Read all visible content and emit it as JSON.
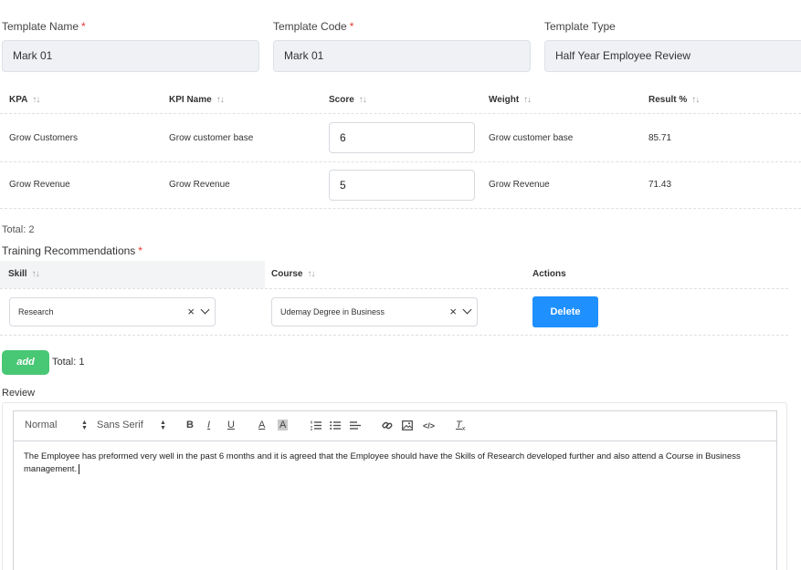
{
  "form": {
    "template_name": {
      "label": "Template Name",
      "required_mark": "*",
      "value": "Mark 01"
    },
    "template_code": {
      "label": "Template Code",
      "required_mark": "*",
      "value": "Mark 01"
    },
    "template_type": {
      "label": "Template Type",
      "value": "Half Year Employee Review"
    }
  },
  "kpa_table": {
    "headers": [
      "KPA",
      "KPI Name",
      "Score",
      "Weight",
      "Result %"
    ],
    "rows": [
      {
        "kpa": "Grow Customers",
        "kpi_name": "Grow customer base",
        "score": "6",
        "weight": "Grow customer base",
        "result": "85.71"
      },
      {
        "kpa": "Grow Revenue",
        "kpi_name": "Grow Revenue",
        "score": "5",
        "weight": "Grow Revenue",
        "result": "71.43"
      }
    ],
    "total": "Total: 2"
  },
  "training": {
    "label": "Training Recommendations",
    "required_mark": "*",
    "headers": {
      "skill": "Skill",
      "course": "Course",
      "actions": "Actions"
    },
    "rows": [
      {
        "skill": "Research",
        "course": "Udemay Degree in Business",
        "delete_label": "Delete"
      }
    ],
    "add_label": "add",
    "total": "Total: 1"
  },
  "review": {
    "label": "Review",
    "toolbar": {
      "header_select": "Normal",
      "font_select": "Sans Serif"
    },
    "text": "The Employee has preformed very well in the past 6 months and it is agreed that the Employee should have the Skills of Research developed further and also attend a Course in Business management."
  },
  "colors": {
    "primary": "#1e90ff",
    "success": "#48c774",
    "required": "#e53935",
    "field_bg": "#eff1f5"
  },
  "icons": [
    "sort-icon",
    "clear-icon",
    "chevron-down-icon",
    "bold-icon",
    "italic-icon",
    "underline-icon",
    "font-color-icon",
    "background-color-icon",
    "ordered-list-icon",
    "bullet-list-icon",
    "align-icon",
    "link-icon",
    "image-icon",
    "code-icon",
    "clear-format-icon"
  ]
}
